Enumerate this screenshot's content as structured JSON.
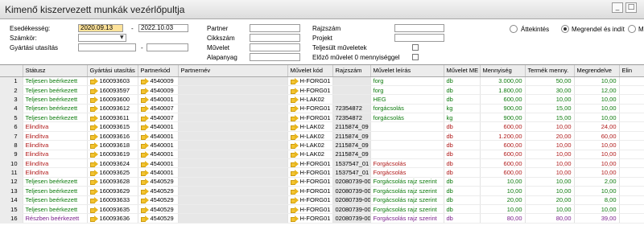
{
  "window": {
    "title": "Kimenő kiszervezett munkák vezérlőpultja"
  },
  "filters": {
    "esedekesseg_label": "Esedékesség:",
    "date_from": "2020.09.13",
    "date_sep": "-",
    "date_to": "2022.10.03",
    "szamkor_label": "Számkör:",
    "gyartasi_label": "Gyártási utasítás",
    "gyartasi_sep": "-",
    "partner_label": "Partner",
    "cikkszam_label": "Cikkszám",
    "muvelet_label": "Művelet",
    "alapanyag_label": "Alapanyag",
    "rajzszam_label": "Rajzszám",
    "projekt_label": "Projekt",
    "teljesult_label": "Teljesült műveletek",
    "elozo_label": "Előző művelet 0 mennyiséggel"
  },
  "view_options": [
    {
      "label": "Áttekintés",
      "selected": false
    },
    {
      "label": "Megrendel és indít",
      "selected": true
    },
    {
      "label": "M",
      "selected": false
    }
  ],
  "grid": {
    "columns": [
      "Státusz",
      "Gyártási utasítás",
      "Partnerkód",
      "Partnernév",
      "Művelet kód",
      "Rajzszám",
      "Művelet leírás",
      "Művelet ME",
      "Mennyiség",
      "Termék menny.",
      "Megrendelve",
      "Elin"
    ],
    "rows": [
      {
        "n": "1",
        "status": "Teljesen beérkezett",
        "color": "green",
        "gy": "160093603",
        "pk": "4540009",
        "mk": "H-FORG01",
        "rajz": "",
        "leiras": "forg",
        "me": "db",
        "menny": "3.000,00",
        "termek": "50,00",
        "megr": "10,00"
      },
      {
        "n": "2",
        "status": "Teljesen beérkezett",
        "color": "green",
        "gy": "160093597",
        "pk": "4540009",
        "mk": "H-FORG01",
        "rajz": "",
        "leiras": "forg",
        "me": "db",
        "menny": "1.800,00",
        "termek": "30,00",
        "megr": "12,00"
      },
      {
        "n": "3",
        "status": "Teljesen beérkezett",
        "color": "green",
        "gy": "160093600",
        "pk": "4540001",
        "mk": "H-LAK02",
        "rajz": "",
        "leiras": "HEG",
        "me": "db",
        "menny": "600,00",
        "termek": "10,00",
        "megr": "10,00"
      },
      {
        "n": "4",
        "status": "Teljesen beérkezett",
        "color": "green",
        "gy": "160093612",
        "pk": "4540007",
        "mk": "H-FORG01",
        "rajz": "72354872",
        "leiras": "forgácsolás",
        "me": "kg",
        "menny": "900,00",
        "termek": "15,00",
        "megr": "10,00"
      },
      {
        "n": "5",
        "status": "Teljesen beérkezett",
        "color": "green",
        "gy": "160093611",
        "pk": "4540007",
        "mk": "H-FORG01",
        "rajz": "72354872",
        "leiras": "forgácsolás",
        "me": "kg",
        "menny": "900,00",
        "termek": "15,00",
        "megr": "10,00"
      },
      {
        "n": "6",
        "status": "Elindítva",
        "color": "red",
        "gy": "160093615",
        "pk": "4540001",
        "mk": "H-LAK02",
        "rajz": "2115874_09",
        "leiras": "",
        "me": "db",
        "menny": "600,00",
        "termek": "10,00",
        "megr": "24,00"
      },
      {
        "n": "7",
        "status": "Elindítva",
        "color": "red",
        "gy": "160093616",
        "pk": "4540001",
        "mk": "H-LAK02",
        "rajz": "2115874_09",
        "leiras": "",
        "me": "db",
        "menny": "1.200,00",
        "termek": "20,00",
        "megr": "60,00"
      },
      {
        "n": "8",
        "status": "Elindítva",
        "color": "red",
        "gy": "160093618",
        "pk": "4540001",
        "mk": "H-LAK02",
        "rajz": "2115874_09",
        "leiras": "",
        "me": "db",
        "menny": "600,00",
        "termek": "10,00",
        "megr": "10,00"
      },
      {
        "n": "9",
        "status": "Elindítva",
        "color": "red",
        "gy": "160093619",
        "pk": "4540001",
        "mk": "H-LAK02",
        "rajz": "2115874_09",
        "leiras": "",
        "me": "db",
        "menny": "600,00",
        "termek": "10,00",
        "megr": "10,00"
      },
      {
        "n": "10",
        "status": "Elindítva",
        "color": "red",
        "gy": "160093624",
        "pk": "4540001",
        "mk": "H-FORG01",
        "rajz": "1537547_01",
        "leiras": "Forgácsolás",
        "me": "db",
        "menny": "600,00",
        "termek": "10,00",
        "megr": "10,00"
      },
      {
        "n": "11",
        "status": "Elindítva",
        "color": "red",
        "gy": "160093625",
        "pk": "4540001",
        "mk": "H-FORG01",
        "rajz": "1537547_01",
        "leiras": "Forgácsolás",
        "me": "db",
        "menny": "600,00",
        "termek": "10,00",
        "megr": "10,00"
      },
      {
        "n": "12",
        "status": "Teljesen beérkezett",
        "color": "green",
        "gy": "160093628",
        "pk": "4540529",
        "mk": "H-FORG01",
        "rajz": "02080739-00",
        "leiras": "Forgácsolás rajz szerint",
        "me": "db",
        "menny": "10,00",
        "termek": "10,00",
        "megr": "2,00"
      },
      {
        "n": "13",
        "status": "Teljesen beérkezett",
        "color": "green",
        "gy": "160093629",
        "pk": "4540529",
        "mk": "H-FORG01",
        "rajz": "02080739-00",
        "leiras": "Forgácsolás rajz szerint",
        "me": "db",
        "menny": "10,00",
        "termek": "10,00",
        "megr": "10,00"
      },
      {
        "n": "14",
        "status": "Teljesen beérkezett",
        "color": "green",
        "gy": "160093633",
        "pk": "4540529",
        "mk": "H-FORG01",
        "rajz": "02080739-00",
        "leiras": "Forgácsolás rajz szerint",
        "me": "db",
        "menny": "20,00",
        "termek": "20,00",
        "megr": "8,00"
      },
      {
        "n": "15",
        "status": "Teljesen beérkezett",
        "color": "green",
        "gy": "160093635",
        "pk": "4540529",
        "mk": "H-FORG01",
        "rajz": "02080739-00",
        "leiras": "Forgácsolás rajz szerint",
        "me": "db",
        "menny": "10,00",
        "termek": "10,00",
        "megr": "10,00"
      },
      {
        "n": "16",
        "status": "Részben beérkezett",
        "color": "purple",
        "gy": "160093636",
        "pk": "4540529",
        "mk": "H-FORG01",
        "rajz": "02080739-00",
        "leiras": "Forgácsolás rajz szerint",
        "me": "db",
        "menny": "80,00",
        "termek": "80,00",
        "megr": "39,00"
      }
    ]
  }
}
